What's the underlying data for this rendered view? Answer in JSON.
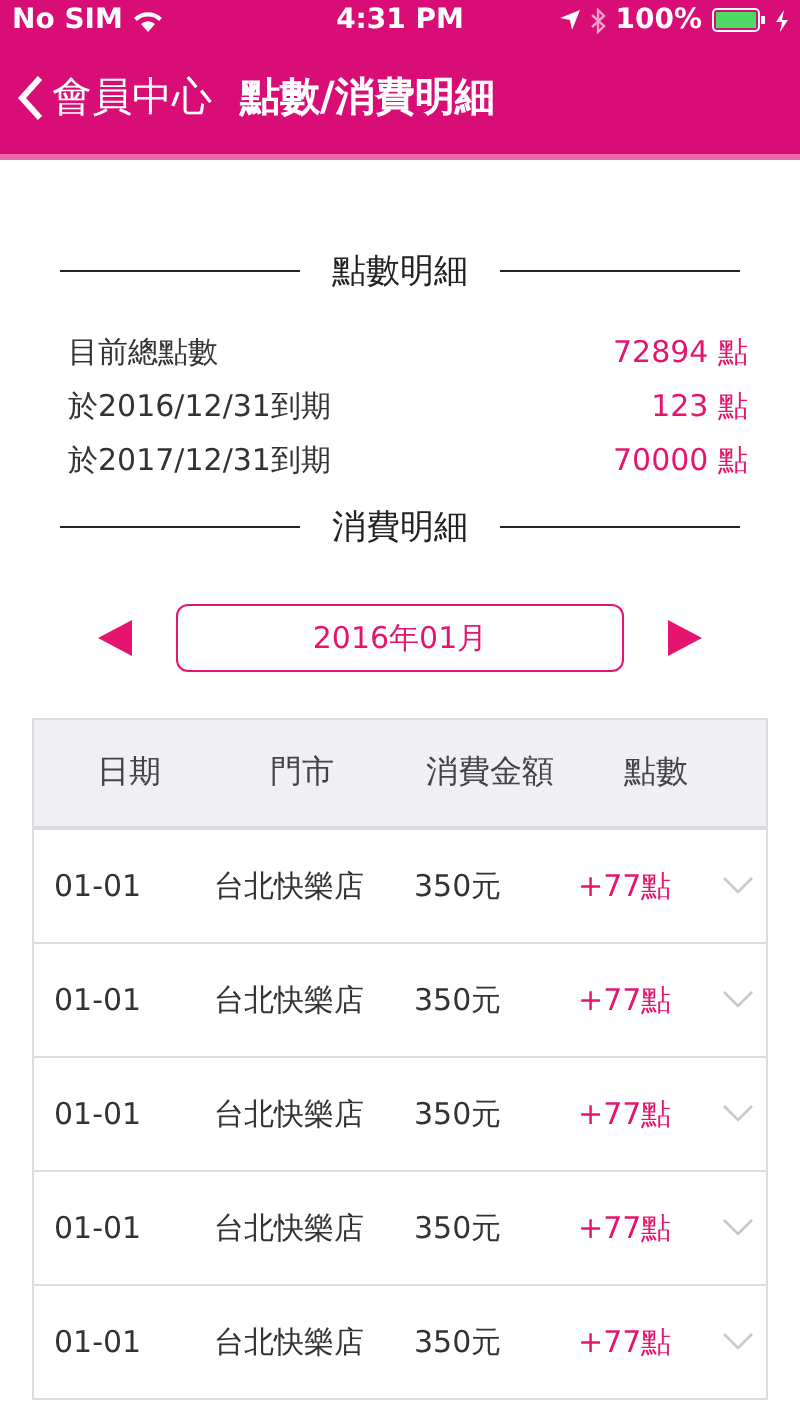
{
  "status_bar": {
    "carrier": "No SIM",
    "time": "4:31 PM",
    "battery": "100%"
  },
  "nav": {
    "back_label": "會員中心",
    "title": "點數/消費明細"
  },
  "points_section": {
    "title": "點數明細",
    "rows": [
      {
        "label": "目前總點數",
        "value": "72894 點"
      },
      {
        "label": "於2016/12/31到期",
        "value": "123 點"
      },
      {
        "label": "於2017/12/31到期",
        "value": "70000 點"
      }
    ]
  },
  "spending_section": {
    "title": "消費明細",
    "month": "2016年01月"
  },
  "table": {
    "columns": [
      "日期",
      "門市",
      "消費金額",
      "點數"
    ],
    "rows": [
      {
        "date": "01-01",
        "store": "台北快樂店",
        "amount": "350元",
        "points": "+77點"
      },
      {
        "date": "01-01",
        "store": "台北快樂店",
        "amount": "350元",
        "points": "+77點"
      },
      {
        "date": "01-01",
        "store": "台北快樂店",
        "amount": "350元",
        "points": "+77點"
      },
      {
        "date": "01-01",
        "store": "台北快樂店",
        "amount": "350元",
        "points": "+77點"
      },
      {
        "date": "01-01",
        "store": "台北快樂店",
        "amount": "350元",
        "points": "+77點"
      }
    ]
  }
}
